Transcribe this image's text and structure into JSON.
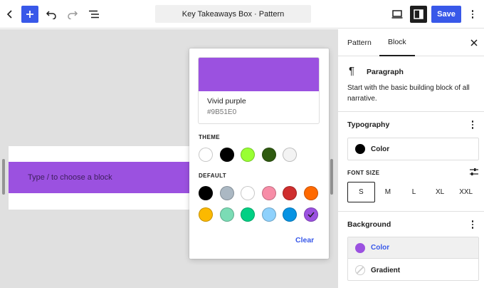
{
  "topbar": {
    "document_title": "Key Takeaways Box · Pattern",
    "save_label": "Save"
  },
  "canvas": {
    "block_placeholder": "Type / to choose a block",
    "block_background": "#9B51E0"
  },
  "color_picker": {
    "selected_name": "Vivid purple",
    "selected_hex": "#9B51E0",
    "theme_label": "THEME",
    "default_label": "DEFAULT",
    "clear_label": "Clear",
    "theme_colors": [
      "#ffffff",
      "#000000",
      "#99ff33",
      "#2f5a10",
      "#f3f3f3"
    ],
    "default_colors": [
      "#000000",
      "#abb8c3",
      "#ffffff",
      "#f78da7",
      "#cf2e2e",
      "#ff6900",
      "#fcb900",
      "#7bdcb5",
      "#00d084",
      "#8ed1fc",
      "#0693e3",
      "#9b51e0"
    ],
    "selected_default_index": 11
  },
  "sidebar": {
    "tabs": [
      {
        "label": "Pattern"
      },
      {
        "label": "Block"
      }
    ],
    "active_tab": "Block",
    "block": {
      "icon": "¶",
      "name": "Paragraph",
      "description": "Start with the basic building block of all narrative."
    },
    "typography": {
      "title": "Typography",
      "color_label": "Color",
      "color_value": "#000000",
      "font_size_label": "FONT SIZE",
      "font_sizes": [
        "S",
        "M",
        "L",
        "XL",
        "XXL"
      ],
      "active_font_size": "S"
    },
    "background": {
      "title": "Background",
      "color_label": "Color",
      "color_value": "#9B51E0",
      "gradient_label": "Gradient"
    }
  },
  "colors": {
    "accent": "#3858e9",
    "dark": "#1e1e1e",
    "canvas_bg": "#e0e0e0"
  }
}
